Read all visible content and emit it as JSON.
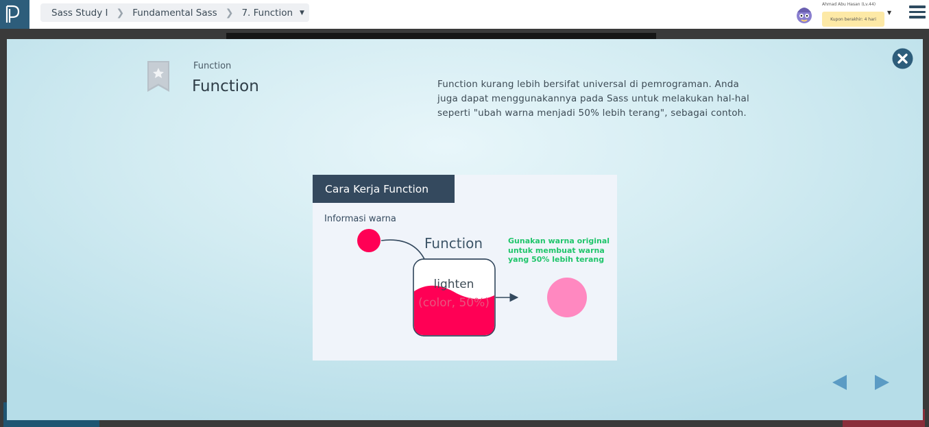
{
  "topbar": {
    "logo_icon": "progate-logo-icon",
    "breadcrumb": [
      "Sass Study I",
      "Fundamental Sass",
      "7. Function"
    ],
    "user_name": "Ahmad Abu Hasan (Lv.44)",
    "coupon": "Kupon berakhir: 4 hari",
    "menu_icon": "hamburger-menu-icon"
  },
  "modal": {
    "label": "Function",
    "title": "Function",
    "description": "Function kurang lebih bersifat universal di pemrograman. Anda juga dapat menggunakannya pada Sass untuk melakukan hal-hal seperti \"ubah warna menjadi 50% lebih terang\", sebagai contoh.",
    "slide": {
      "title": "Cara Kerja Function",
      "info_label": "Informasi warna",
      "function_label": "Function",
      "function_line1": "lighten",
      "function_line2": "(color, 50%)",
      "note": "Gunakan warna original untuk membuat warna yang 50% lebih terang"
    }
  },
  "colors": {
    "accent": "#2d5d7b",
    "original_color": "#ff0055",
    "lightened_color": "#ff88c0"
  }
}
